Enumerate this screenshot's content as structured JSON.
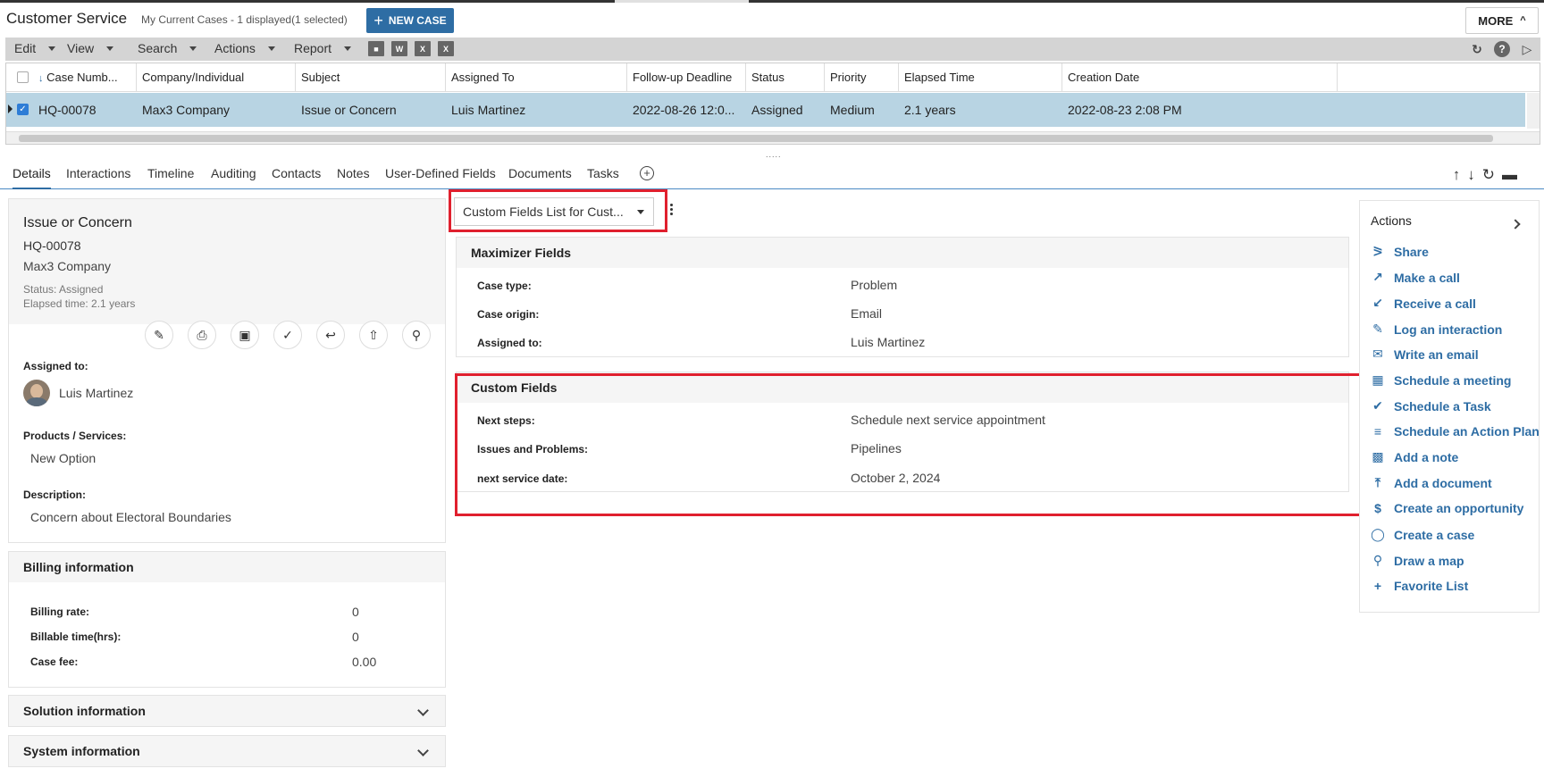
{
  "header": {
    "title": "Customer Service",
    "subtitle": "My Current Cases - 1 displayed(1 selected)",
    "new_case_label": "NEW CASE",
    "more_label": "MORE"
  },
  "menu": {
    "items": [
      "Edit",
      "View",
      "Search",
      "Actions",
      "Report"
    ],
    "tool_icons": [
      "contact-card-icon",
      "word-icon",
      "excel-icon",
      "excel-link-icon"
    ],
    "right_icons": [
      "refresh-icon",
      "help-icon",
      "video-icon"
    ]
  },
  "grid": {
    "columns": [
      "Case Numb...",
      "Company/Individual",
      "Subject",
      "Assigned To",
      "Follow-up Deadline",
      "Status",
      "Priority",
      "Elapsed Time",
      "Creation Date"
    ],
    "rows": [
      {
        "case_number": "HQ-00078",
        "company": "Max3 Company",
        "subject": "Issue or Concern",
        "assigned_to": "Luis Martinez",
        "followup": "2022-08-26 12:0...",
        "status": "Assigned",
        "priority": "Medium",
        "elapsed": "2.1 years",
        "created": "2022-08-23 2:08 PM",
        "selected": true
      }
    ]
  },
  "splitter": ".....",
  "tabs": [
    "Details",
    "Interactions",
    "Timeline",
    "Auditing",
    "Contacts",
    "Notes",
    "User-Defined Fields",
    "Documents",
    "Tasks"
  ],
  "active_tab": "Details",
  "summary": {
    "title": "Issue or Concern",
    "case_id": "HQ-00078",
    "company": "Max3 Company",
    "status_label": "Status:",
    "status_value": "Assigned",
    "elapsed_label": "Elapsed time:",
    "elapsed_value": "2.1 years",
    "assigned_label": "Assigned to:",
    "assigned_value": "Luis Martinez",
    "products_label": "Products / Services:",
    "products_value": "New Option",
    "description_label": "Description:",
    "description_value": "Concern about Electoral Boundaries"
  },
  "billing": {
    "title": "Billing information",
    "rate_label": "Billing rate:",
    "rate_value": "0",
    "time_label": "Billable time(hrs):",
    "time_value": "0",
    "fee_label": "Case fee:",
    "fee_value": "0.00"
  },
  "solution": {
    "title": "Solution information"
  },
  "system": {
    "title": "System information"
  },
  "fields_dropdown": "Custom Fields List for Cust...",
  "maximizer_fields": {
    "title": "Maximizer Fields",
    "rows": [
      {
        "label": "Case type:",
        "value": "Problem"
      },
      {
        "label": "Case origin:",
        "value": "Email"
      },
      {
        "label": "Assigned to:",
        "value": "Luis Martinez"
      }
    ]
  },
  "custom_fields": {
    "title": "Custom Fields",
    "rows": [
      {
        "label": "Next steps:",
        "value": "Schedule next service appointment"
      },
      {
        "label": "Issues and Problems:",
        "value": "Pipelines"
      },
      {
        "label": "next service date:",
        "value": "October 2, 2024"
      }
    ]
  },
  "actions": {
    "title": "Actions",
    "items": [
      {
        "label": "Share",
        "icon": "share-icon"
      },
      {
        "label": "Make a call",
        "icon": "outgoing-call-icon"
      },
      {
        "label": "Receive a call",
        "icon": "incoming-call-icon"
      },
      {
        "label": "Log an interaction",
        "icon": "log-icon"
      },
      {
        "label": "Write an email",
        "icon": "email-icon"
      },
      {
        "label": "Schedule a meeting",
        "icon": "calendar-icon"
      },
      {
        "label": "Schedule a Task",
        "icon": "task-check-icon"
      },
      {
        "label": "Schedule an Action Plan",
        "icon": "action-plan-icon"
      },
      {
        "label": "Add a note",
        "icon": "note-icon"
      },
      {
        "label": "Add a document",
        "icon": "upload-icon"
      },
      {
        "label": "Create an opportunity",
        "icon": "dollar-icon"
      },
      {
        "label": "Create a case",
        "icon": "chat-case-icon"
      },
      {
        "label": "Draw a map",
        "icon": "map-pin-icon"
      },
      {
        "label": "Favorite List",
        "icon": "plus-icon"
      }
    ]
  },
  "colors": {
    "accent": "#2e6da4",
    "selected_row": "#b8d4e3",
    "highlight_box": "#e0202e"
  }
}
